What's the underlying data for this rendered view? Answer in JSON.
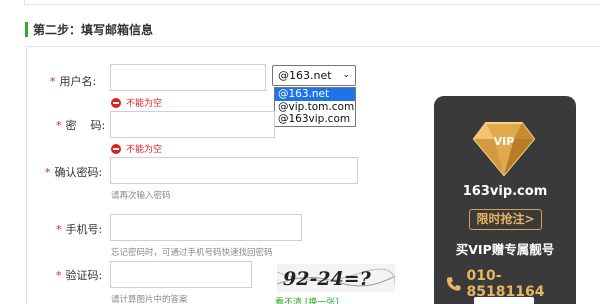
{
  "step": {
    "title": "第二步：填写邮箱信息"
  },
  "form": {
    "username": {
      "label": "用户名:",
      "value": ""
    },
    "domain_select": {
      "value": "@163.net",
      "options": [
        "@163.net",
        "@vip.tom.com",
        "@163vip.com"
      ]
    },
    "username_error": "不能为空",
    "password": {
      "label": "密    码:",
      "value": ""
    },
    "password_error": "不能为空",
    "confirm": {
      "label": "确认密码:",
      "value": "",
      "hint": "请再次输入密码"
    },
    "phone": {
      "label": "手机号:",
      "value": "",
      "hint": "忘记密码时，可通过手机号码快速找回密码"
    },
    "captcha": {
      "label": "验证码:",
      "value": "",
      "hint": "请计算图片中的答案",
      "image_text": "92-24=?",
      "refresh": "看不清 [换一张]"
    }
  },
  "vip": {
    "badge": "VIP",
    "domain": "163vip.com",
    "cta": "限时抢注>",
    "slogan": "买VIP赠专属靓号",
    "phone": "010-85181164",
    "icon": "phone-icon",
    "colors": {
      "gold": "#e8b560",
      "card": "#3a3a3a"
    }
  },
  "colors": {
    "accent": "#2eaa2e",
    "error": "#e02020",
    "selected": "#1e73e8"
  }
}
